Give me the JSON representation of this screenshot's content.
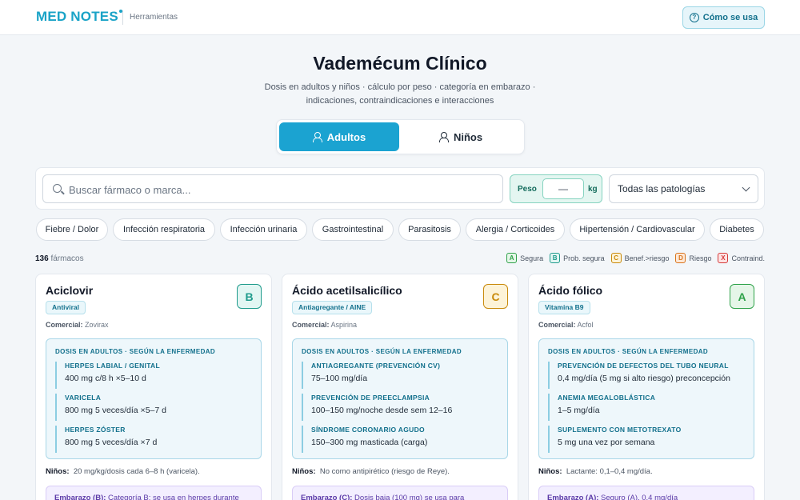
{
  "header": {
    "logo": "MED NOTES",
    "tools": "Herramientas",
    "how_label": "Cómo se usa"
  },
  "hero": {
    "title": "Vademécum Clínico",
    "subtitle_line1": "Dosis en adultos y niños · cálculo por peso · categoría en embarazo ·",
    "subtitle_line2": "indicaciones, contraindicaciones e interacciones"
  },
  "mode": {
    "adults": "Adultos",
    "children": "Niños",
    "active": "Adultos"
  },
  "search": {
    "placeholder": "Buscar fármaco o marca...",
    "weight_label": "Peso",
    "weight_value": "—",
    "weight_unit": "kg",
    "pathology": "Todas las patologías"
  },
  "chips": [
    "Fiebre / Dolor",
    "Infección respiratoria",
    "Infección urinaria",
    "Gastrointestinal",
    "Parasitosis",
    "Alergia / Corticoides",
    "Hipertensión / Cardiovascular",
    "Diabetes"
  ],
  "results": {
    "count": "136",
    "count_label": "fármacos"
  },
  "legend": [
    {
      "letter": "A",
      "label": "Segura",
      "color": "#2fa24a",
      "bg": "#e5f6e8"
    },
    {
      "letter": "B",
      "label": "Prob. segura",
      "color": "#1f9b8c",
      "bg": "#e2f6f3"
    },
    {
      "letter": "C",
      "label": "Benef.>riesgo",
      "color": "#c98a0b",
      "bg": "#fdf3d8"
    },
    {
      "letter": "D",
      "label": "Riesgo",
      "color": "#d9731c",
      "bg": "#fde8d6"
    },
    {
      "letter": "X",
      "label": "Contraind.",
      "color": "#d63a3a",
      "bg": "#fde3e3"
    }
  ],
  "cards": [
    {
      "name": "Aciclovir",
      "tag": "Antiviral",
      "category": "B",
      "badge_color": "#1f9b8c",
      "badge_bg": "#e2f6f3",
      "commercial_label": "Comercial:",
      "commercial": "Zovirax",
      "dose_header": "DOSIS EN ADULTOS · SEGÚN LA ENFERMEDAD",
      "doses": [
        {
          "title": "HERPES LABIAL / GENITAL",
          "value": "400 mg c/8 h ×5–10 d"
        },
        {
          "title": "VARICELA",
          "value": "800 mg 5 veces/día ×5–7 d"
        },
        {
          "title": "HERPES ZÓSTER",
          "value": "800 mg 5 veces/día ×7 d"
        }
      ],
      "children_label": "Niños:",
      "children": "20 mg/kg/dosis cada 6–8 h (varicela).",
      "pregnancy_label": "Embarazo (B):",
      "pregnancy": "Categoría B; se usa en herpes durante"
    },
    {
      "name": "Ácido acetilsalicílico",
      "tag": "Antiagregante / AINE",
      "category": "C",
      "badge_color": "#c98a0b",
      "badge_bg": "#fdf3d8",
      "commercial_label": "Comercial:",
      "commercial": "Aspirina",
      "dose_header": "DOSIS EN ADULTOS · SEGÚN LA ENFERMEDAD",
      "doses": [
        {
          "title": "ANTIAGREGANTE (PREVENCIÓN CV)",
          "value": "75–100 mg/día"
        },
        {
          "title": "PREVENCIÓN DE PREECLAMPSIA",
          "value": "100–150 mg/noche desde sem 12–16"
        },
        {
          "title": "SÍNDROME CORONARIO AGUDO",
          "value": "150–300 mg masticada (carga)"
        }
      ],
      "children_label": "Niños:",
      "children": "No como antipirético (riesgo de Reye).",
      "pregnancy_label": "Embarazo (C):",
      "pregnancy": "Dosis baja (100 mg) se usa para"
    },
    {
      "name": "Ácido fólico",
      "tag": "Vitamina B9",
      "category": "A",
      "badge_color": "#2fa24a",
      "badge_bg": "#e5f6e8",
      "commercial_label": "Comercial:",
      "commercial": "Acfol",
      "dose_header": "DOSIS EN ADULTOS · SEGÚN LA ENFERMEDAD",
      "doses": [
        {
          "title": "PREVENCIÓN DE DEFECTOS DEL TUBO NEURAL",
          "value": "0,4 mg/día (5 mg si alto riesgo) preconcepción"
        },
        {
          "title": "ANEMIA MEGALOBLÁSTICA",
          "value": "1–5 mg/día"
        },
        {
          "title": "SUPLEMENTO CON METOTREXATO",
          "value": "5 mg una vez por semana"
        }
      ],
      "children_label": "Niños:",
      "children": "Lactante: 0,1–0,4 mg/día.",
      "pregnancy_label": "Embarazo (A):",
      "pregnancy": "Seguro (A). 0,4 mg/día"
    }
  ]
}
